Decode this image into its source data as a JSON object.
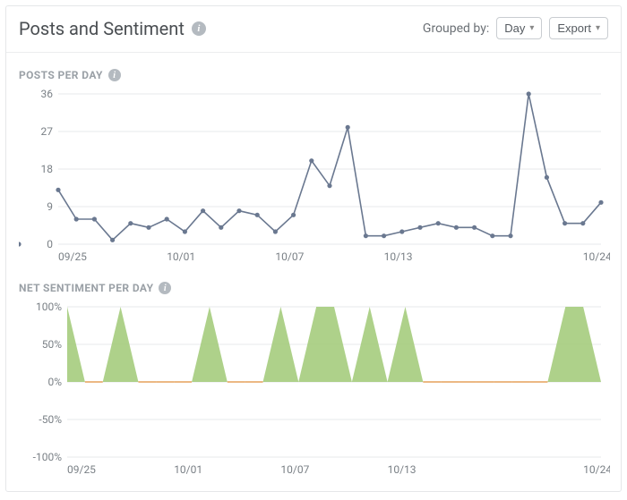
{
  "header": {
    "title": "Posts and Sentiment",
    "grouped_label": "Grouped by:",
    "group_selected": "Day",
    "export_label": "Export"
  },
  "sections": {
    "posts_title": "POSTS PER DAY",
    "sentiment_title": "NET SENTIMENT PER DAY"
  },
  "icons": {
    "info_glyph": "i"
  },
  "chart_data": [
    {
      "type": "line",
      "title": "POSTS PER DAY",
      "xlabel": "",
      "ylabel": "",
      "ylim": [
        0,
        36
      ],
      "y_ticks": [
        0,
        9,
        18,
        27,
        36
      ],
      "x_tick_labels": [
        "09/25",
        "10/01",
        "10/07",
        "10/13",
        "10/24"
      ],
      "x_tick_indices": [
        0,
        6,
        12,
        18,
        29
      ],
      "x": [
        0,
        1,
        2,
        3,
        4,
        5,
        6,
        7,
        8,
        9,
        10,
        11,
        12,
        13,
        14,
        15,
        16,
        17,
        18,
        19,
        20,
        21,
        22,
        23,
        24,
        25,
        26,
        27,
        28,
        29,
        30
      ],
      "values": [
        13,
        6,
        6,
        1,
        5,
        4,
        6,
        3,
        8,
        4,
        8,
        7,
        3,
        7,
        20,
        14,
        28,
        2,
        2,
        3,
        4,
        5,
        4,
        4,
        2,
        2,
        36,
        16,
        5,
        5,
        10,
        0
      ]
    },
    {
      "type": "area",
      "title": "NET SENTIMENT PER DAY",
      "xlabel": "",
      "ylabel": "",
      "ylim": [
        -100,
        100
      ],
      "y_ticks": [
        -100,
        -50,
        0,
        50,
        100
      ],
      "y_tick_labels": [
        "-100%",
        "-50%",
        "0%",
        "50%",
        "100%"
      ],
      "x_tick_labels": [
        "09/25",
        "10/01",
        "10/07",
        "10/13",
        "10/24"
      ],
      "x_tick_indices": [
        0,
        6,
        12,
        18,
        29
      ],
      "x": [
        0,
        1,
        2,
        3,
        4,
        5,
        6,
        7,
        8,
        9,
        10,
        11,
        12,
        13,
        14,
        15,
        16,
        17,
        18,
        19,
        20,
        21,
        22,
        23,
        24,
        25,
        26,
        27,
        28,
        29,
        30
      ],
      "values": [
        100,
        0,
        0,
        100,
        0,
        0,
        0,
        0,
        100,
        0,
        0,
        0,
        100,
        0,
        100,
        100,
        0,
        100,
        0,
        100,
        0,
        0,
        0,
        0,
        0,
        0,
        0,
        0,
        100,
        100,
        0
      ]
    }
  ]
}
